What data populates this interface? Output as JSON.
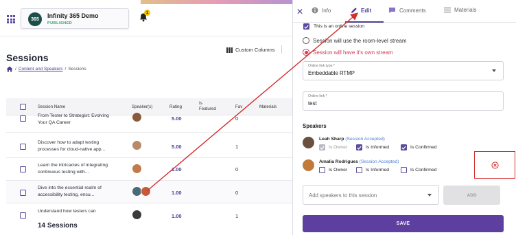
{
  "app": {
    "event_logo_text": "365",
    "event_name": "Infinity 365 Demo",
    "event_status": "PUBLISHED",
    "notification_count": "1"
  },
  "page": {
    "title": "Sessions",
    "custom_columns_label": "Custom Columns",
    "breadcrumb": {
      "parent": "Content and Speakers",
      "current": "Sessions"
    },
    "footer_count": "14 Sessions"
  },
  "table": {
    "headers": {
      "session_name": "Session Name",
      "speakers": "Speaker(s)",
      "rating": "Rating",
      "featured": "Is Featured",
      "fav": "Fav",
      "materials": "Materials"
    },
    "rows": [
      {
        "title": "From Tester to Strategist: Evolving Your QA Career",
        "rating": "5.00",
        "fav": "0",
        "avatars": [
          "#8a5a3c"
        ]
      },
      {
        "title": "Discover how to adapt testing processes for cloud-native app...",
        "rating": "5.00",
        "fav": "1",
        "avatars": [
          "#b98a6a"
        ]
      },
      {
        "title": "Learn the intricacies of integrating continuous testing with...",
        "rating": "1.00",
        "fav": "0",
        "avatars": [
          "#c27a4a"
        ]
      },
      {
        "title": "Dive into the essential realm of accessibility testing, ensu...",
        "rating": "1.00",
        "fav": "0",
        "avatars": [
          "#4a6a7a",
          "#c85a3a"
        ]
      },
      {
        "title": "Understand how testers can",
        "rating": "1.00",
        "fav": "1",
        "avatars": [
          "#3a3a3a"
        ]
      }
    ]
  },
  "panel": {
    "tabs": [
      {
        "label": "Info",
        "icon": "info-icon"
      },
      {
        "label": "Edit",
        "icon": "pencil-icon"
      },
      {
        "label": "Comments",
        "icon": "comment-icon"
      },
      {
        "label": "Materials",
        "icon": "list-icon"
      }
    ],
    "online_session_label": "This is an online session",
    "radio_room_stream": "Session will use the room-level stream",
    "radio_own_stream": "Session will have it's own stream",
    "online_link_type": {
      "label": "Online link type *",
      "value": "Embeddable RTMP"
    },
    "online_link": {
      "label": "Online link *",
      "value": "test"
    },
    "speakers_title": "Speakers",
    "speakers": [
      {
        "name": "Leah Sharp",
        "status": "(Session Accepted)",
        "is_owner": "Is Owner",
        "is_informed": "Is Informed",
        "is_confirmed": "Is Confirmed",
        "avatar_color": "#6b5040"
      },
      {
        "name": "Amalia Rodrigues",
        "status": "(Session Accepted)",
        "is_owner": "Is Owner",
        "is_informed": "Is Informed",
        "is_confirmed": "Is Confirmed",
        "avatar_color": "#c07a3a"
      }
    ],
    "add_speakers_placeholder": "Add speakers to this session",
    "add_button": "ADD",
    "save_button": "SAVE"
  },
  "colors": {
    "accent": "#5b4a9e",
    "save": "#5d3fa0",
    "annotation_red": "#d32f2f",
    "selected_radio": "#d33b55",
    "status_published": "#2e9e57"
  }
}
